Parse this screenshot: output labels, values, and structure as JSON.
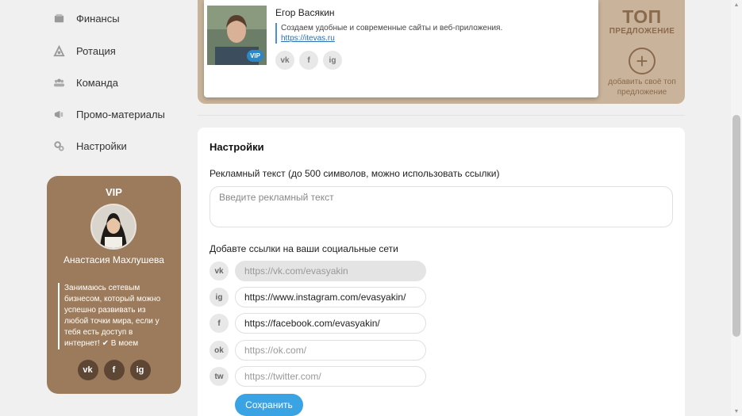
{
  "nav": {
    "items": [
      {
        "label": "Финансы",
        "icon": "wallet-icon"
      },
      {
        "label": "Ротация",
        "icon": "rotation-icon"
      },
      {
        "label": "Команда",
        "icon": "team-icon"
      },
      {
        "label": "Промо-материалы",
        "icon": "megaphone-icon"
      },
      {
        "label": "Настройки",
        "icon": "gears-icon"
      }
    ]
  },
  "vip": {
    "title": "VIP",
    "name": "Анастасия Махлушева",
    "text": "Занимаюсь сетевым бизнесом, который можно успешно развивать из любой точки мира, если у тебя есть доступ в интернет! ✔ В моем",
    "socials": [
      "vk",
      "f",
      "ig"
    ]
  },
  "profile": {
    "name": "Егор Васякин",
    "badge": "VIP",
    "description": "Создаем удобные и современные сайты и веб-приложения.",
    "link": "https://itevas.ru",
    "socials": [
      "vk",
      "f",
      "ig"
    ]
  },
  "top_offer": {
    "title_big": "ТОП",
    "title_small": "ПРЕДЛОЖЕНИЕ",
    "add_symbol": "+",
    "add_label": "добавить своё топ предложение"
  },
  "settings": {
    "title": "Настройки",
    "ad_label": "Рекламный текст (до 500 символов, можно использовать ссылки)",
    "ad_placeholder": "Введите рекламный текст",
    "links_label": "Добавте ссылки на ваши социальные сети",
    "links": [
      {
        "network": "vk",
        "icon_text": "vk",
        "value": "",
        "placeholder": "https://vk.com/evasyakin",
        "disabled": true
      },
      {
        "network": "instagram",
        "icon_text": "ig",
        "value": "https://www.instagram.com/evasyakin/",
        "placeholder": "",
        "disabled": false
      },
      {
        "network": "facebook",
        "icon_text": "f",
        "value": "https://facebook.com/evasyakin/",
        "placeholder": "",
        "disabled": false
      },
      {
        "network": "odnoklassniki",
        "icon_text": "ok",
        "value": "",
        "placeholder": "https://ok.com/",
        "disabled": false
      },
      {
        "network": "twitter",
        "icon_text": "tw",
        "value": "",
        "placeholder": "https://twitter.com/",
        "disabled": false
      }
    ],
    "save_label": "Сохранить"
  },
  "colors": {
    "vip_card": "#9b7b5b",
    "top_strip": "#c9b49b",
    "accent": "#3aa3e3"
  }
}
